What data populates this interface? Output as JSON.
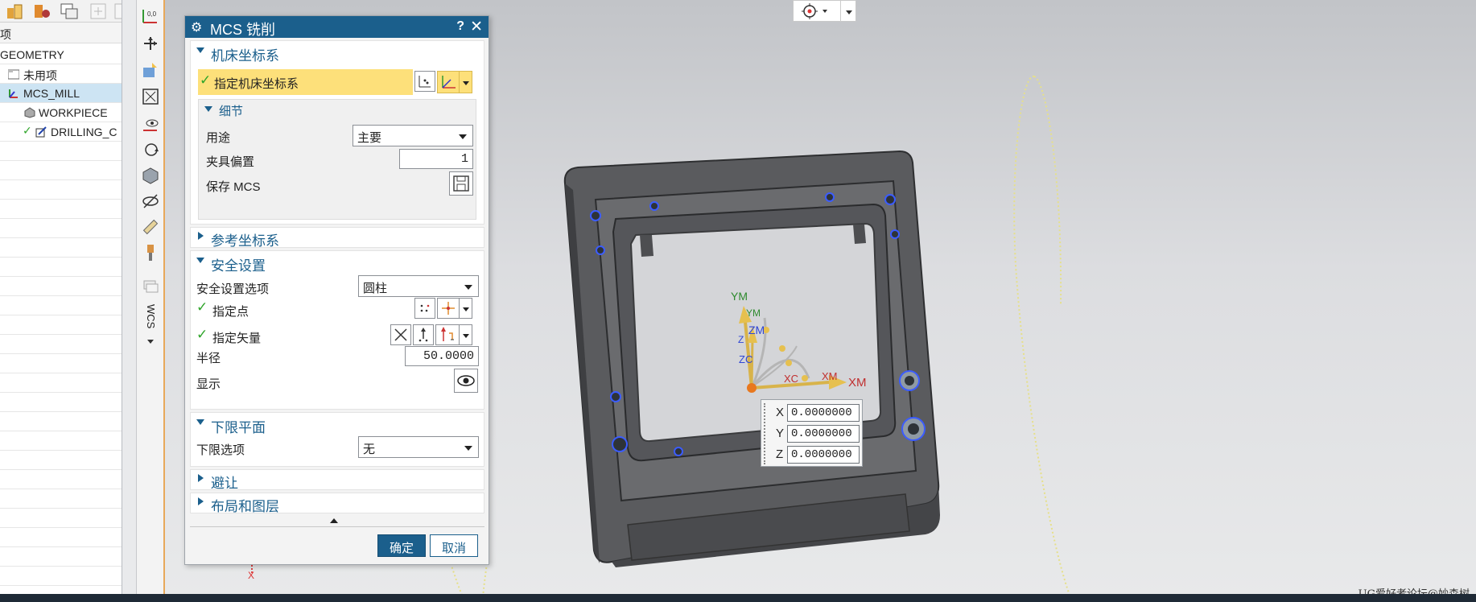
{
  "navigator": {
    "header": "项",
    "geometry_root": "GEOMETRY",
    "items": [
      {
        "label": "未用项"
      },
      {
        "label": "MCS_MILL"
      },
      {
        "label": "WORKPIECE"
      },
      {
        "label": "DRILLING_C"
      }
    ]
  },
  "resource_bar": {
    "label": "WCS"
  },
  "dialog": {
    "title": "MCS 铣削",
    "help": "?",
    "close": "✕",
    "machine_cs": {
      "title": "机床坐标系",
      "specify_label": "指定机床坐标系",
      "details": {
        "title": "细节",
        "purpose_label": "用途",
        "purpose_value": "主要",
        "fixture_offset_label": "夹具偏置",
        "fixture_offset_value": "1",
        "save_mcs_label": "保存 MCS"
      }
    },
    "reference_cs": {
      "title": "参考坐标系"
    },
    "safety": {
      "title": "安全设置",
      "option_label": "安全设置选项",
      "option_value": "圆柱",
      "point_label": "指定点",
      "vector_label": "指定矢量",
      "radius_label": "半径",
      "radius_value": "50.0000",
      "display_label": "显示"
    },
    "lower_plane": {
      "title": "下限平面",
      "option_label": "下限选项",
      "option_value": "无"
    },
    "avoidance": {
      "title": "避让"
    },
    "layout": {
      "title": "布局和图层"
    },
    "ok_label": "确定",
    "cancel_label": "取消"
  },
  "triad": {
    "labels": [
      "YM",
      "YM",
      "ZM",
      "Z",
      "ZC",
      "XC",
      "XM",
      "XM"
    ]
  },
  "coord_popup": {
    "rows": [
      {
        "axis": "X",
        "value": "0.0000000"
      },
      {
        "axis": "Y",
        "value": "0.0000000"
      },
      {
        "axis": "Z",
        "value": "0.0000000"
      }
    ]
  },
  "view_axis_label": "X",
  "watermark": "UG爱好者论坛@妙森树",
  "colors": {
    "title_bar": "#1b5f8c",
    "highlight_row": "#fde07a",
    "check": "#2fa52a",
    "selected_tree_row": "#cde4f3"
  }
}
